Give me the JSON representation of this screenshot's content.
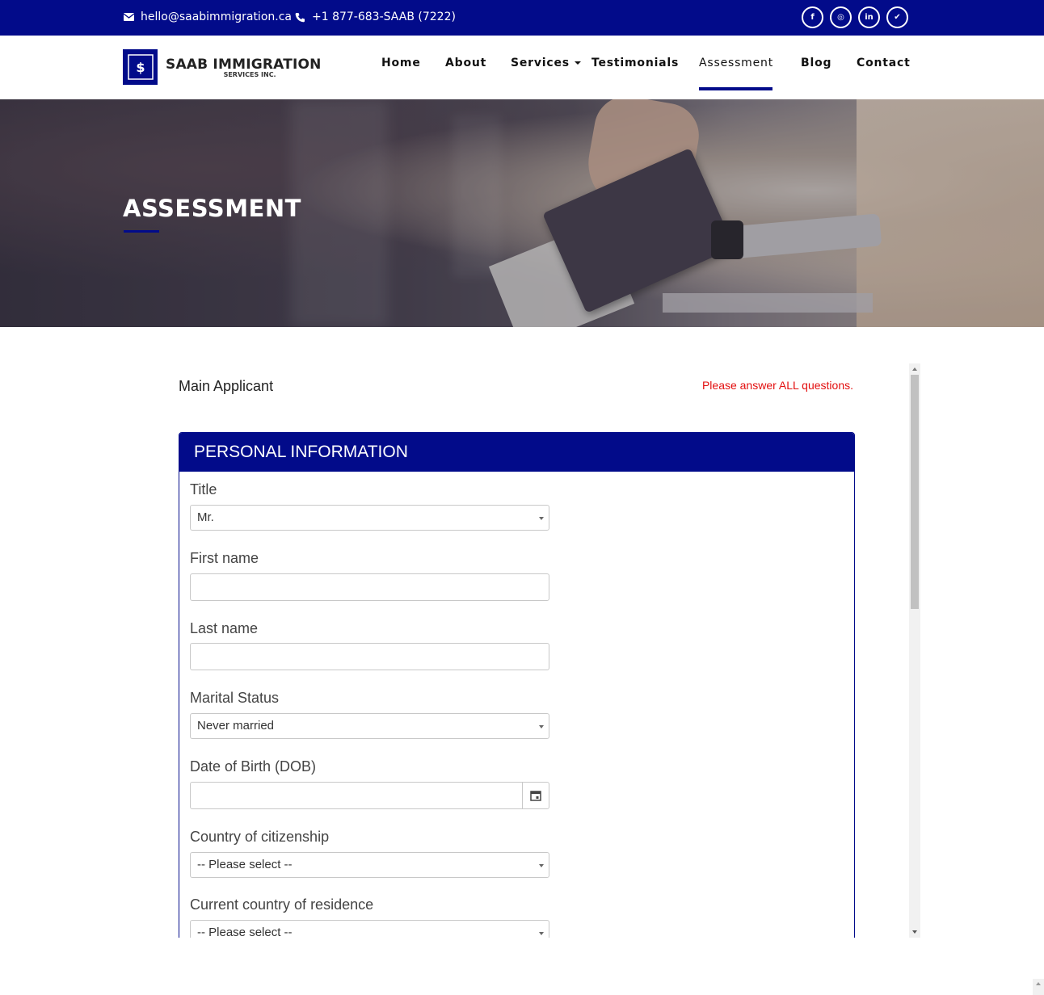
{
  "topbar": {
    "email": "hello@saabimmigration.ca",
    "phone": "+1 877-683-SAAB (7222)",
    "social": [
      {
        "icon": "facebook-icon",
        "glyph": "f"
      },
      {
        "icon": "instagram-icon",
        "glyph": "◎"
      },
      {
        "icon": "linkedin-icon",
        "glyph": "in"
      },
      {
        "icon": "twitter-icon",
        "glyph": "✔"
      }
    ]
  },
  "header": {
    "logo_title": "SAAB IMMIGRATION",
    "logo_sub": "SERVICES INC.",
    "nav": {
      "home": "Home",
      "about": "About",
      "services": "Services",
      "testimonials": "Testimonials",
      "assessment": "Assessment",
      "blog": "Blog",
      "contact": "Contact"
    },
    "active": "Assessment"
  },
  "hero": {
    "title": "ASSESSMENT"
  },
  "form": {
    "main_applicant": "Main Applicant",
    "warning": "Please answer ALL questions.",
    "section_title": "PERSONAL INFORMATION",
    "fields": {
      "title": {
        "label": "Title",
        "value": "Mr."
      },
      "first_name": {
        "label": "First name",
        "value": ""
      },
      "last_name": {
        "label": "Last name",
        "value": ""
      },
      "marital_status": {
        "label": "Marital Status",
        "value": "Never married"
      },
      "dob": {
        "label": "Date of Birth (DOB)",
        "value": ""
      },
      "citizenship": {
        "label": "Country of citizenship",
        "value": "-- Please select --"
      },
      "residence": {
        "label": "Current country of residence",
        "value": "-- Please select --"
      }
    }
  },
  "colors": {
    "brand": "#020b8a",
    "warning": "#e30f0f"
  }
}
